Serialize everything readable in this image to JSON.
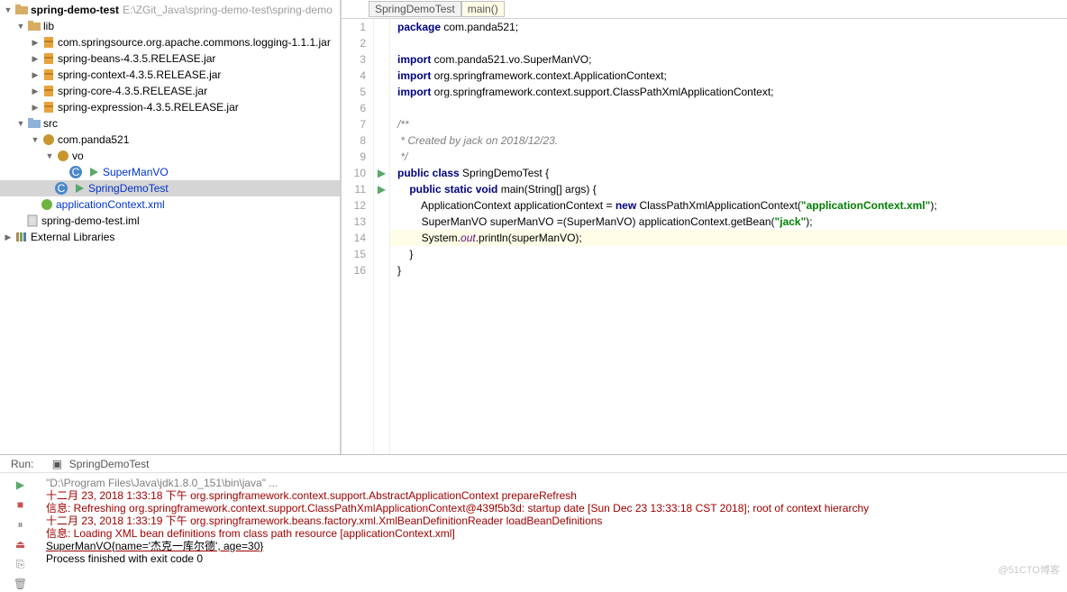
{
  "project": {
    "root": {
      "name": "spring-demo-test",
      "path": "E:\\ZGit_Java\\spring-demo-test\\spring-demo"
    },
    "lib": {
      "label": "lib",
      "jars": [
        "com.springsource.org.apache.commons.logging-1.1.1.jar",
        "spring-beans-4.3.5.RELEASE.jar",
        "spring-context-4.3.5.RELEASE.jar",
        "spring-core-4.3.5.RELEASE.jar",
        "spring-expression-4.3.5.RELEASE.jar"
      ]
    },
    "src": {
      "label": "src",
      "pkg": "com.panda521",
      "vo": "vo",
      "classes": [
        "SuperManVO",
        "SpringDemoTest"
      ],
      "appctx": "applicationContext.xml",
      "iml": "spring-demo-test.iml"
    },
    "extlib": "External Libraries"
  },
  "breadcrumb": {
    "class": "SpringDemoTest",
    "method": "main()"
  },
  "code": {
    "l1_a": "package",
    "l1_b": " com.panda521;",
    "l3_a": "import",
    "l3_b": " com.panda521.vo.SuperManVO;",
    "l4_a": "import",
    "l4_b": " org.springframework.context.ApplicationContext;",
    "l5_a": "import",
    "l5_b": " org.springframework.context.support.ClassPathXmlApplicationContext;",
    "l7": "/**",
    "l8": " * Created by jack on 2018/12/23.",
    "l9": " */",
    "l10_a": "public class",
    "l10_b": " SpringDemoTest {",
    "l11_a": "public static void",
    "l11_b": " main(String[] args) {",
    "l12_a": "ApplicationContext applicationContext = ",
    "l12_b": "new",
    "l12_c": " ClassPathXmlApplicationContext(",
    "l12_d": "\"applicationContext.xml\"",
    "l12_e": ");",
    "l13_a": "SuperManVO superManVO =(SuperManVO) applicationContext.getBean(",
    "l13_b": "\"jack\"",
    "l13_c": ");",
    "l14_a": "System.",
    "l14_b": "out",
    "l14_c": ".println(superManVO);",
    "l15": "}",
    "l16": "}"
  },
  "run": {
    "label_run": "Run:",
    "tab": "SpringDemoTest",
    "lines": [
      "\"D:\\Program Files\\Java\\jdk1.8.0_151\\bin\\java\" ...",
      "十二月 23, 2018 1:33:18 下午 org.springframework.context.support.AbstractApplicationContext prepareRefresh",
      "信息: Refreshing org.springframework.context.support.ClassPathXmlApplicationContext@439f5b3d: startup date [Sun Dec 23 13:33:18 CST 2018]; root of context hierarchy",
      "十二月 23, 2018 1:33:19 下午 org.springframework.beans.factory.xml.XmlBeanDefinitionReader loadBeanDefinitions",
      "信息: Loading XML bean definitions from class path resource [applicationContext.xml]",
      "SuperManVO{name='杰克一库尔德', age=30}",
      "",
      "Process finished with exit code 0"
    ]
  },
  "watermark": "@51CTO博客"
}
